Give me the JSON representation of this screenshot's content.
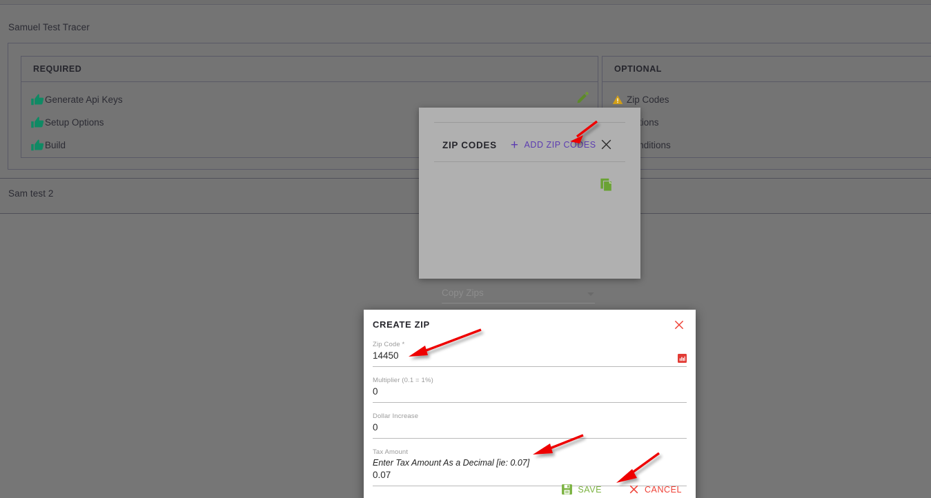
{
  "page": {
    "sections": [
      {
        "title": "Samuel Test Tracer"
      },
      {
        "title": "Sam test 2"
      }
    ]
  },
  "card": {
    "columns": [
      {
        "header": "REQUIRED",
        "items": [
          {
            "label": "Generate Api Keys",
            "icon": "thumbs-up-icon",
            "status_color": "#0f8a64"
          },
          {
            "label": "Setup Options",
            "icon": "thumbs-up-icon",
            "status_color": "#0f8a64"
          },
          {
            "label": "Build",
            "icon": "thumbs-up-icon",
            "status_color": "#0f8a64"
          }
        ],
        "edit_icon": "pencil-icon"
      },
      {
        "header": "OPTIONAL",
        "items": [
          {
            "label": "Zip Codes",
            "icon": "warning-triangle-icon",
            "status_color": "#d4a017"
          },
          {
            "label": "Options",
            "icon": "warning-triangle-icon",
            "status_color": "#d4a017"
          },
          {
            "label": "Conditions",
            "icon": "warning-triangle-icon",
            "status_color": "#d4a017"
          }
        ]
      }
    ]
  },
  "zip_modal": {
    "title": "ZIP CODES",
    "add_zip_codes_label": "ADD ZIP CODES",
    "add_zip_codes_color": "#5b3bb0",
    "close_icon": "close-icon",
    "copy_zips_placeholder": "Copy Zips",
    "copy_icon": "copy-icon",
    "copy_icon_color": "#6aa234",
    "add_zip_code_label": "ADD ZIP CODE",
    "background": "#b0b0b0"
  },
  "create_zip": {
    "title": "CREATE ZIP",
    "close_icon": "close-icon",
    "close_color": "#ef4136",
    "fields": [
      {
        "label": "Zip Code *",
        "value": "14450",
        "hint": "",
        "trailing_icon": "red-keypad-icon"
      },
      {
        "label": "Multiplier (0.1 = 1%)",
        "value": "0",
        "hint": ""
      },
      {
        "label": "Dollar Increase",
        "value": "0",
        "hint": ""
      },
      {
        "label": "Tax Amount",
        "value": "0.07",
        "hint": "Enter Tax Amount As a Decimal [ie: 0.07]"
      }
    ],
    "save_label": "SAVE",
    "save_icon": "save-disk-icon",
    "save_color": "#7cb342",
    "cancel_label": "CANCEL",
    "cancel_icon": "close-icon",
    "cancel_color": "#ef4136"
  },
  "annotations": {
    "color": "#ee0000",
    "arrows": [
      {
        "name": "arrow-to-add-zip-codes"
      },
      {
        "name": "arrow-to-zip-code-value"
      },
      {
        "name": "arrow-to-tax-amount"
      },
      {
        "name": "arrow-to-save-button"
      }
    ]
  },
  "theme": {
    "page_background": "#747474",
    "overlay_background": "#767676",
    "border": "#595966",
    "text": "#2b2b33"
  }
}
